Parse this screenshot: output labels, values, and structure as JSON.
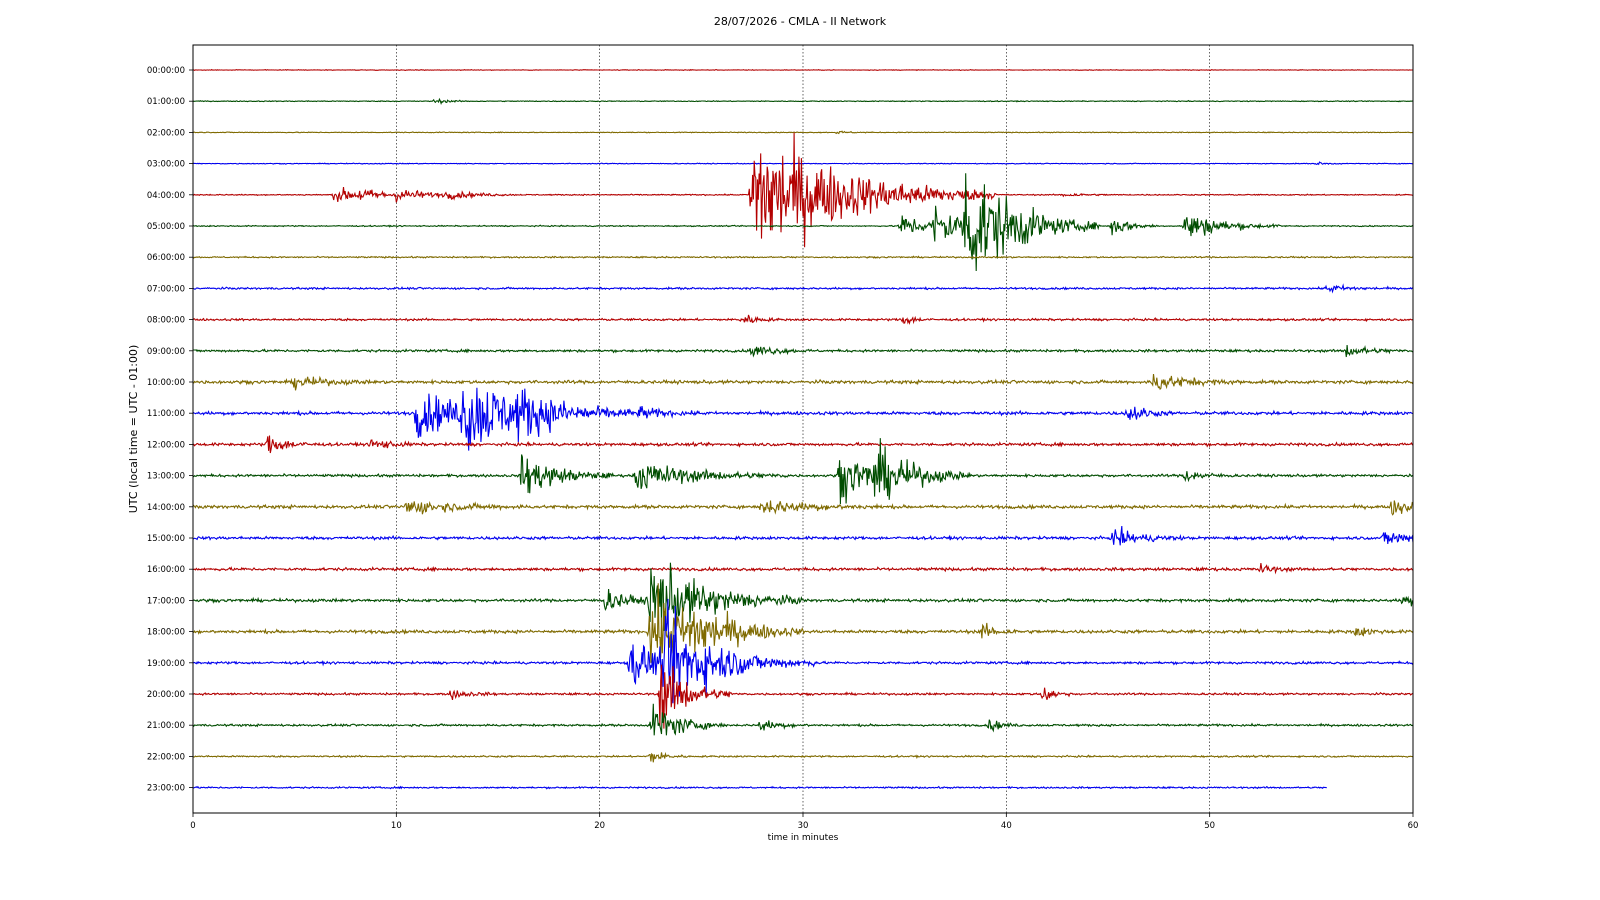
{
  "chart_data": {
    "type": "line",
    "title": "28/07/2026 - CMLA - II Network",
    "xlabel": "time in minutes",
    "ylabel": "UTC (local time = UTC - 01:00)",
    "xlim": [
      0,
      60
    ],
    "x_ticks": [
      "0",
      "10",
      "20",
      "30",
      "40",
      "50",
      "60"
    ],
    "grid": "vertical dotted lines at 10-minute intervals",
    "row_labels": [
      "00:00:00",
      "01:00:00",
      "02:00:00",
      "03:00:00",
      "04:00:00",
      "05:00:00",
      "06:00:00",
      "07:00:00",
      "08:00:00",
      "09:00:00",
      "10:00:00",
      "11:00:00",
      "12:00:00",
      "13:00:00",
      "14:00:00",
      "15:00:00",
      "16:00:00",
      "17:00:00",
      "18:00:00",
      "19:00:00",
      "20:00:00",
      "21:00:00",
      "22:00:00",
      "23:00:00"
    ],
    "color_cycle": [
      "#b30000",
      "#004d00",
      "#7f6a00",
      "#0000ee"
    ],
    "row_noise": [
      0.4,
      0.5,
      0.5,
      0.5,
      0.7,
      0.7,
      0.9,
      1.2,
      1.3,
      1.5,
      2.0,
      2.0,
      1.8,
      1.6,
      2.0,
      1.8,
      1.8,
      1.8,
      2.0,
      1.5,
      1.3,
      1.3,
      1.0,
      1.0
    ],
    "row_end_minute": [
      60,
      60,
      60,
      60,
      60,
      60,
      60,
      60,
      60,
      60,
      60,
      60,
      60,
      60,
      60,
      60,
      60,
      60,
      60,
      60,
      60,
      60,
      60,
      55.8
    ],
    "events": [
      {
        "row": 1,
        "t": 11.9,
        "amp": 3,
        "dur": 0.6
      },
      {
        "row": 2,
        "t": 31.7,
        "amp": 2,
        "dur": 0.5
      },
      {
        "row": 3,
        "t": 55.3,
        "amp": 2,
        "dur": 0.4
      },
      {
        "row": 4,
        "t": 7.0,
        "amp": 10,
        "dur": 1.5
      },
      {
        "row": 4,
        "t": 8.2,
        "amp": 5,
        "dur": 1.0
      },
      {
        "row": 4,
        "t": 10.0,
        "amp": 6,
        "dur": 2.0
      },
      {
        "row": 4,
        "t": 12.5,
        "amp": 4,
        "dur": 1.0
      },
      {
        "row": 4,
        "t": 27.5,
        "amp": 95,
        "dur": 4.0
      },
      {
        "row": 4,
        "t": 42.8,
        "amp": 3,
        "dur": 0.8
      },
      {
        "row": 5,
        "t": 34.8,
        "amp": 15,
        "dur": 1.5
      },
      {
        "row": 5,
        "t": 36.5,
        "amp": 25,
        "dur": 1.8
      },
      {
        "row": 5,
        "t": 38.0,
        "amp": 75,
        "dur": 2.2
      },
      {
        "row": 5,
        "t": 40.5,
        "amp": 6,
        "dur": 0.5
      },
      {
        "row": 5,
        "t": 45.2,
        "amp": 14,
        "dur": 0.8
      },
      {
        "row": 5,
        "t": 48.8,
        "amp": 20,
        "dur": 1.6
      },
      {
        "row": 7,
        "t": 55.8,
        "amp": 5,
        "dur": 1.0
      },
      {
        "row": 8,
        "t": 27.0,
        "amp": 8,
        "dur": 0.6
      },
      {
        "row": 8,
        "t": 34.9,
        "amp": 8,
        "dur": 0.5
      },
      {
        "row": 9,
        "t": 27.5,
        "amp": 8,
        "dur": 1.0
      },
      {
        "row": 9,
        "t": 56.7,
        "amp": 8,
        "dur": 1.0
      },
      {
        "row": 10,
        "t": 5.0,
        "amp": 8,
        "dur": 1.2
      },
      {
        "row": 10,
        "t": 47.2,
        "amp": 12,
        "dur": 1.5
      },
      {
        "row": 11,
        "t": 11.0,
        "amp": 30,
        "dur": 2.5
      },
      {
        "row": 11,
        "t": 13.3,
        "amp": 45,
        "dur": 2.8
      },
      {
        "row": 11,
        "t": 16.0,
        "amp": 15,
        "dur": 2.0
      },
      {
        "row": 11,
        "t": 22.0,
        "amp": 8,
        "dur": 1.0
      },
      {
        "row": 11,
        "t": 46.0,
        "amp": 14,
        "dur": 0.7
      },
      {
        "row": 12,
        "t": 3.7,
        "amp": 14,
        "dur": 0.8
      },
      {
        "row": 12,
        "t": 8.8,
        "amp": 8,
        "dur": 0.8
      },
      {
        "row": 13,
        "t": 16.2,
        "amp": 30,
        "dur": 1.5
      },
      {
        "row": 13,
        "t": 21.8,
        "amp": 20,
        "dur": 2.5
      },
      {
        "row": 13,
        "t": 31.8,
        "amp": 30,
        "dur": 2.0
      },
      {
        "row": 13,
        "t": 33.5,
        "amp": 28,
        "dur": 1.6
      },
      {
        "row": 13,
        "t": 48.8,
        "amp": 8,
        "dur": 0.8
      },
      {
        "row": 14,
        "t": 10.5,
        "amp": 10,
        "dur": 2.0
      },
      {
        "row": 14,
        "t": 28.0,
        "amp": 10,
        "dur": 2.0
      },
      {
        "row": 14,
        "t": 59.0,
        "amp": 10,
        "dur": 1.5
      },
      {
        "row": 15,
        "t": 45.3,
        "amp": 12,
        "dur": 1.2
      },
      {
        "row": 15,
        "t": 58.6,
        "amp": 10,
        "dur": 1.5
      },
      {
        "row": 16,
        "t": 52.5,
        "amp": 6,
        "dur": 0.6
      },
      {
        "row": 17,
        "t": 20.3,
        "amp": 16,
        "dur": 1.0
      },
      {
        "row": 17,
        "t": 22.5,
        "amp": 55,
        "dur": 2.5
      },
      {
        "row": 17,
        "t": 59.5,
        "amp": 8,
        "dur": 0.8
      },
      {
        "row": 18,
        "t": 22.5,
        "amp": 50,
        "dur": 2.5
      },
      {
        "row": 18,
        "t": 24.5,
        "amp": 20,
        "dur": 1.5
      },
      {
        "row": 18,
        "t": 38.8,
        "amp": 9,
        "dur": 0.7
      },
      {
        "row": 18,
        "t": 57.2,
        "amp": 7,
        "dur": 0.6
      },
      {
        "row": 19,
        "t": 21.5,
        "amp": 30,
        "dur": 2.0
      },
      {
        "row": 19,
        "t": 23.2,
        "amp": 55,
        "dur": 2.5
      },
      {
        "row": 20,
        "t": 12.7,
        "amp": 6,
        "dur": 0.8
      },
      {
        "row": 20,
        "t": 23.0,
        "amp": 50,
        "dur": 1.2
      },
      {
        "row": 20,
        "t": 41.8,
        "amp": 12,
        "dur": 0.5
      },
      {
        "row": 21,
        "t": 22.6,
        "amp": 30,
        "dur": 1.2
      },
      {
        "row": 21,
        "t": 27.9,
        "amp": 8,
        "dur": 0.8
      },
      {
        "row": 21,
        "t": 39.2,
        "amp": 8,
        "dur": 0.5
      },
      {
        "row": 22,
        "t": 22.5,
        "amp": 10,
        "dur": 0.6
      }
    ]
  }
}
